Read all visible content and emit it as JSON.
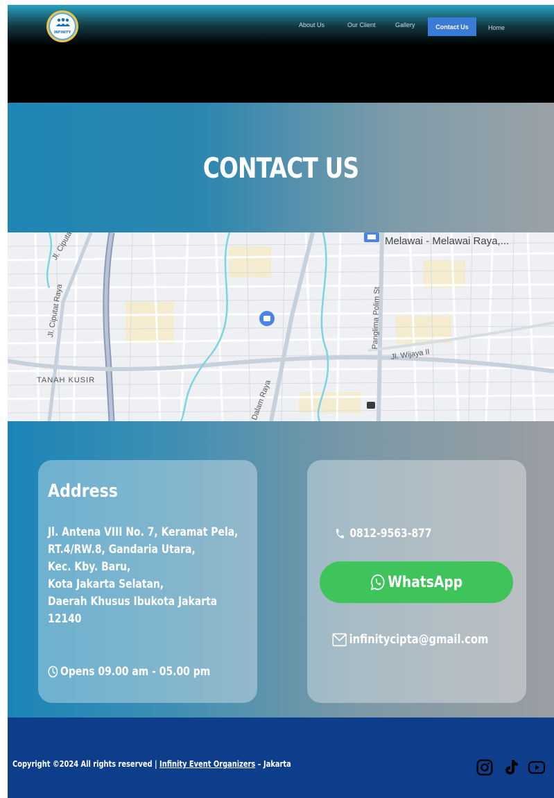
{
  "header": {
    "logo_text": "INFINITY",
    "nav": {
      "about": "About Us",
      "client": "Our Client",
      "gallery": "Gallery",
      "contact": "Contact Us",
      "home": "Home"
    }
  },
  "hero": {
    "title": "CONTACT US"
  },
  "map": {
    "labels": {
      "melawai": "Melawai - Melawai Raya,...",
      "ciputat1": "Jl. Ciputat",
      "ciputat2": "Jl. Ciputat Raya",
      "polim": "Panglima Polim St",
      "wijaya": "Jl. Wijaya II",
      "tanah": "TANAH KUSIR",
      "dalam": "Dalam Raya"
    }
  },
  "address": {
    "title": "Address",
    "lines": [
      "Jl. Antena VIII No. 7, Keramat Pela,",
      "RT.4/RW.8, Gandaria Utara,",
      "Kec. Kby. Baru,",
      "Kota Jakarta Selatan,",
      "Daerah Khusus Ibukota Jakarta",
      "12140"
    ],
    "hours": "Opens 09.00 am - 05.00 pm"
  },
  "contact": {
    "phone": "0812-9563-877",
    "whatsapp": "WhatsApp",
    "email": "infinitycipta@gmail.com"
  },
  "footer": {
    "copyright_prefix": "Copyright ©2024 All rights reserved | ",
    "company_link": "Infinity Event Organizers",
    "copyright_suffix": " – Jakarta"
  },
  "colors": {
    "nav_active": "#3a7bd5",
    "whatsapp": "#3ec45a",
    "footer": "#0e3d8c",
    "hero_start": "#1e86b5",
    "hero_end": "#9aa2a7"
  },
  "icons": {
    "phone": "phone-icon",
    "whatsapp": "whatsapp-icon",
    "email": "mail-icon",
    "clock": "clock-icon",
    "instagram": "instagram-icon",
    "tiktok": "tiktok-icon",
    "youtube": "youtube-icon"
  }
}
